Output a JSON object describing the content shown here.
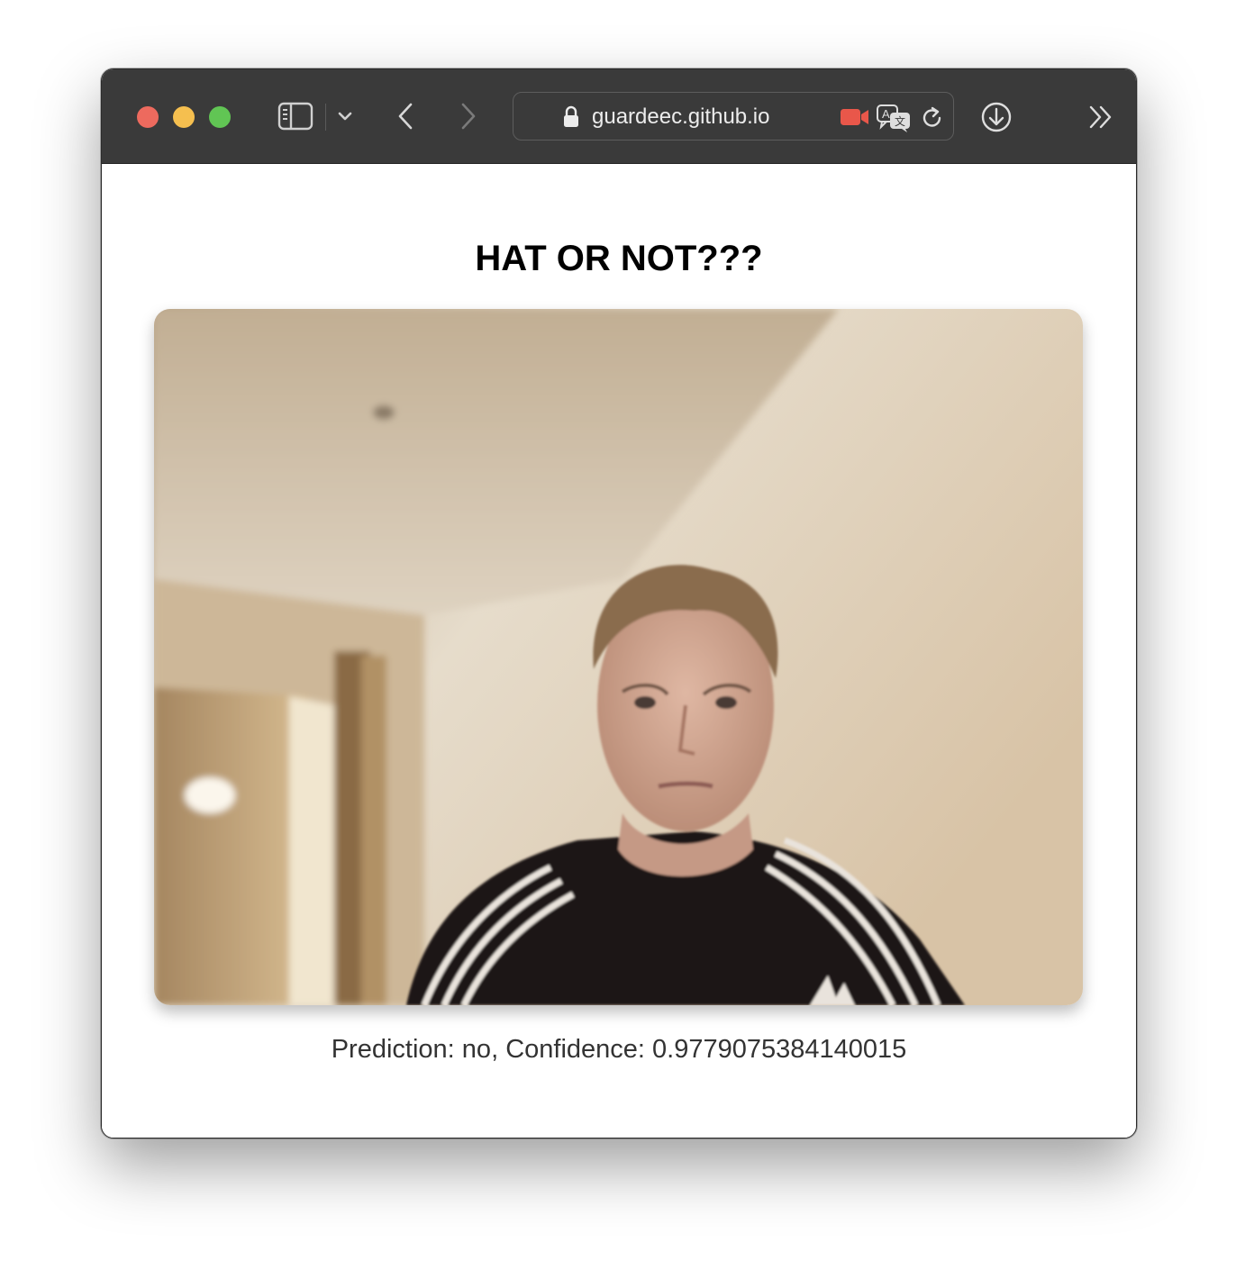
{
  "browser": {
    "address_bar": {
      "url": "guardeec.github.io"
    },
    "icons": {
      "sidebar": "sidebar-icon",
      "dropdown": "chevron-down-icon",
      "back": "chevron-left-icon",
      "forward": "chevron-right-icon",
      "lock": "lock-icon",
      "camera": "camera-icon",
      "translate": "translate-icon",
      "reload": "reload-icon",
      "download": "download-icon",
      "more": "double-chevron-right-icon"
    },
    "colors": {
      "close": "#ed6a5e",
      "minimize": "#f5bf4f",
      "zoom": "#61c554",
      "camera_active": "#e9574a"
    }
  },
  "page": {
    "title": "HAT OR NOT???",
    "prediction_label": "Prediction:",
    "prediction_value": "no",
    "confidence_label": "Confidence:",
    "confidence_value": "0.9779075384140015"
  }
}
